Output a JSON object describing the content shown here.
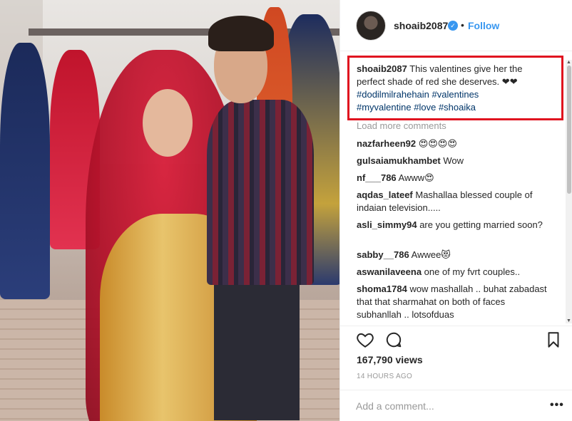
{
  "header": {
    "username": "shoaib2087",
    "verified_icon": "verified-badge-icon",
    "separator": "•",
    "follow_label": "Follow"
  },
  "caption": {
    "username": "shoaib2087",
    "text": " This valentines give her the perfect shade of red she deserves. ",
    "hearts": "❤❤",
    "tags": [
      "#dodilmilrahehain",
      "#valentines",
      "#myvalentine",
      "#love",
      "#shoaika"
    ]
  },
  "load_more": "Load more comments",
  "comments": [
    {
      "user": "nazfarheen92",
      "text": " 😍😍😍😍"
    },
    {
      "user": "gulsaiamukhambet",
      "text": " Wow"
    },
    {
      "user": "nf___786",
      "text": " Awww😍"
    },
    {
      "user": "aqdas_lateef",
      "text": " Mashallaa blessed couple of indaian television....."
    },
    {
      "user": "asli_simmy94",
      "text": " are you getting married soon?"
    },
    {
      "user": "sabby__786",
      "text": " Awwee😻"
    },
    {
      "user": "aswanilaveena",
      "text": " one of my fvrt couples.."
    },
    {
      "user": "shoma1784",
      "text": " wow mashallah .. buhat zabadast that that sharmahat on both of faces subhanllah .. lotsofduas"
    }
  ],
  "stats": {
    "views": "167,790 views",
    "time": "14 HOURS AGO"
  },
  "add_comment": {
    "placeholder": "Add a comment...",
    "more_label": "•••"
  },
  "colors": {
    "link_blue": "#3897f0",
    "hashtag": "#003569",
    "highlight_box": "#e0121f"
  }
}
